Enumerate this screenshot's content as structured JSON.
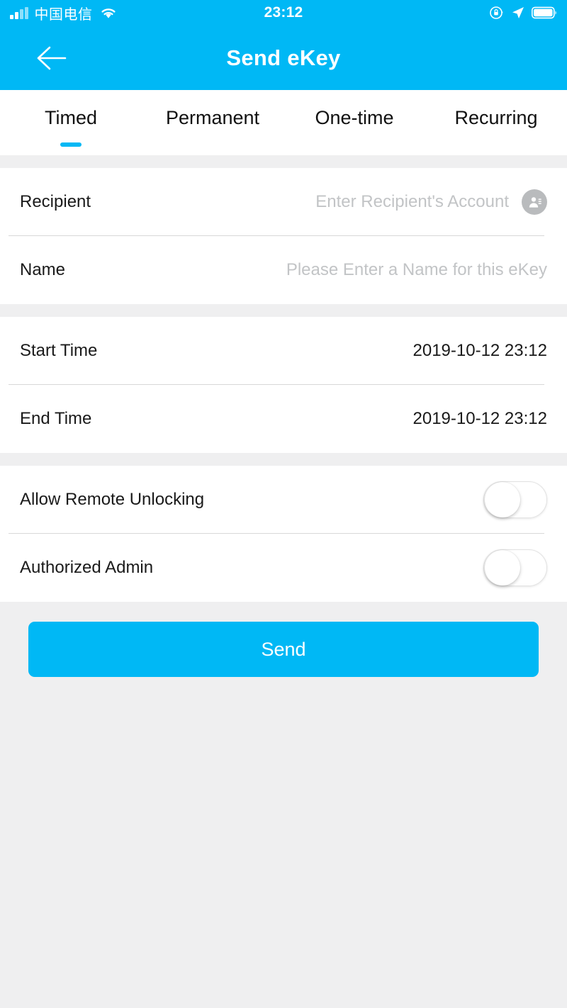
{
  "status_bar": {
    "carrier": "中国电信",
    "time": "23:12",
    "signal_icon": "signal-bars-icon",
    "wifi_icon": "wifi-icon",
    "rotation_lock_icon": "rotation-lock-icon",
    "location_icon": "location-arrow-icon",
    "battery_icon": "battery-full-icon"
  },
  "header": {
    "title": "Send eKey",
    "back_icon": "back-arrow-icon"
  },
  "tabs": {
    "active_index": 0,
    "items": [
      {
        "label": "Timed"
      },
      {
        "label": "Permanent"
      },
      {
        "label": "One-time"
      },
      {
        "label": "Recurring"
      }
    ]
  },
  "form": {
    "recipient": {
      "label": "Recipient",
      "placeholder": "Enter Recipient's Account",
      "value": "",
      "contact_icon": "contact-book-icon"
    },
    "name": {
      "label": "Name",
      "placeholder": "Please Enter a Name for this eKey",
      "value": ""
    },
    "start_time": {
      "label": "Start Time",
      "value": "2019-10-12 23:12"
    },
    "end_time": {
      "label": "End Time",
      "value": "2019-10-12 23:12"
    },
    "allow_remote_unlocking": {
      "label": "Allow Remote Unlocking",
      "state": "off"
    },
    "authorized_admin": {
      "label": "Authorized Admin",
      "state": "off"
    }
  },
  "actions": {
    "send_label": "Send"
  },
  "colors": {
    "accent": "#00b8f5",
    "page_background": "#efeff0",
    "card_background": "#ffffff",
    "divider": "#d8d8d8",
    "placeholder_text": "#c2c4c6",
    "primary_text": "#1a1a1a"
  }
}
